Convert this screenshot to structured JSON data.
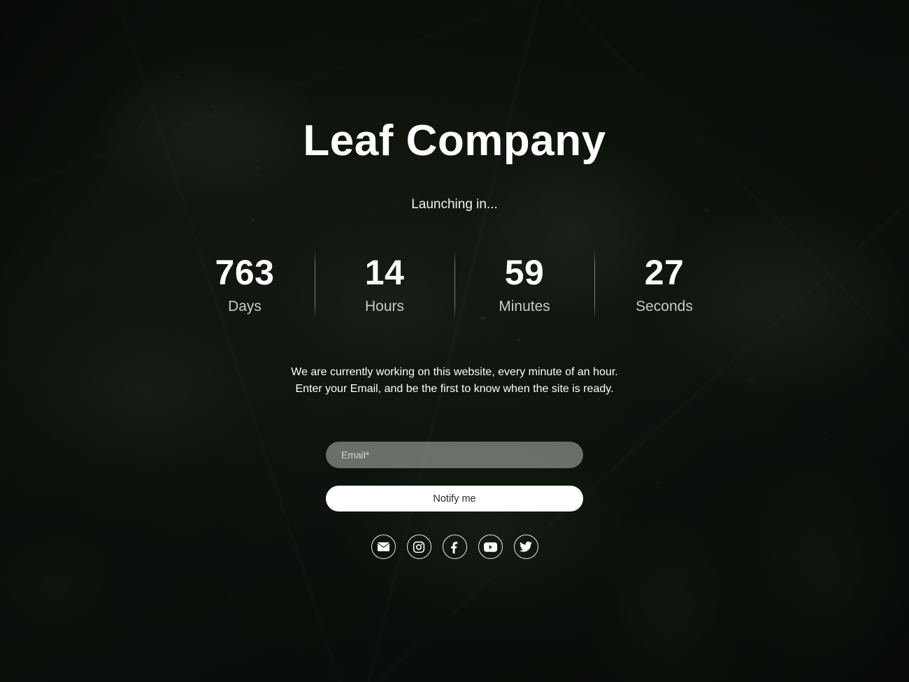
{
  "page": {
    "title": "Leaf Company",
    "tagline": "Launching in..."
  },
  "countdown": {
    "segments": [
      {
        "value": "763",
        "label": "Days"
      },
      {
        "value": "14",
        "label": "Hours"
      },
      {
        "value": "59",
        "label": "Minutes"
      },
      {
        "value": "27",
        "label": "Seconds"
      }
    ]
  },
  "description": {
    "line1": "We are currently working on this website, every minute of an hour.",
    "line2": "Enter your Email, and be the first to know when the site is ready."
  },
  "signup": {
    "email_placeholder": "Email*",
    "email_value": "",
    "notify_label": "Notify me"
  },
  "social": {
    "links": [
      {
        "name": "email-icon",
        "label": "Email"
      },
      {
        "name": "instagram-icon",
        "label": "Instagram"
      },
      {
        "name": "facebook-icon",
        "label": "Facebook"
      },
      {
        "name": "youtube-icon",
        "label": "YouTube"
      },
      {
        "name": "twitter-icon",
        "label": "Twitter"
      }
    ]
  },
  "colors": {
    "text_primary": "#ffffff",
    "text_muted": "#c9cdc6",
    "button_bg": "#ffffff",
    "button_text": "#2c2c2c",
    "input_bg": "rgba(232,238,230,0.42)",
    "background_dark": "#161b15",
    "leaf_green": "#44503e"
  }
}
